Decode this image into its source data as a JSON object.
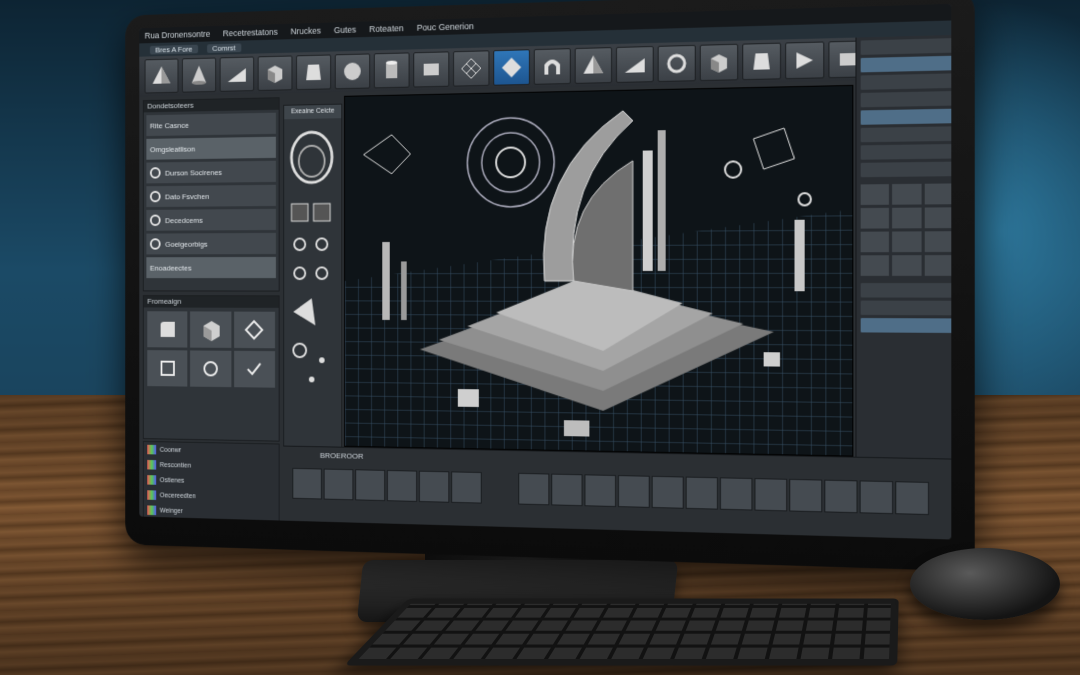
{
  "menubar": {
    "items": [
      "Rua Dronensontre",
      "Recetrestatons",
      "Nruckes",
      "Gutes",
      "Roteaten",
      "Pouc Generion"
    ]
  },
  "tabbar": {
    "tabs": [
      "Bres A Fore",
      "Comrst"
    ]
  },
  "toolbar": {
    "tool_icons": [
      "pyramid-icon",
      "cone-icon",
      "wedge-icon",
      "cube-icon",
      "prism-icon",
      "sphere-icon",
      "cylinder-icon",
      "box-icon",
      "lattice-icon",
      "diamond-icon",
      "arch-icon",
      "pyramid-icon",
      "wedge-icon",
      "ring-icon",
      "cube-icon",
      "prism-icon",
      "slice-icon",
      "box-icon"
    ]
  },
  "left_panel": {
    "title": "Dondetsoteers",
    "items": [
      {
        "label": "Rite Casnce"
      },
      {
        "label": "Omgsleatlison"
      },
      {
        "label": "Durson  Socirenes"
      },
      {
        "label": "Dato Fsvchen"
      },
      {
        "label": "Decedcems"
      },
      {
        "label": "Goeigeorbigs"
      },
      {
        "label": "Enoadeectes"
      }
    ]
  },
  "props_panel": {
    "title": "Fromeaign"
  },
  "tools_column": {
    "title": "Exeaine Ceicte"
  },
  "layers_panel": {
    "rows": [
      "Coonwr",
      "Rescontien",
      "Ostienes",
      "Oecereedten",
      "Weinger"
    ]
  },
  "bottom_bar": {
    "label": "BROEROOR"
  },
  "colors": {
    "accent": "#2f76b8",
    "panel": "#2f3439",
    "wireframe": "#7f9bb3"
  }
}
